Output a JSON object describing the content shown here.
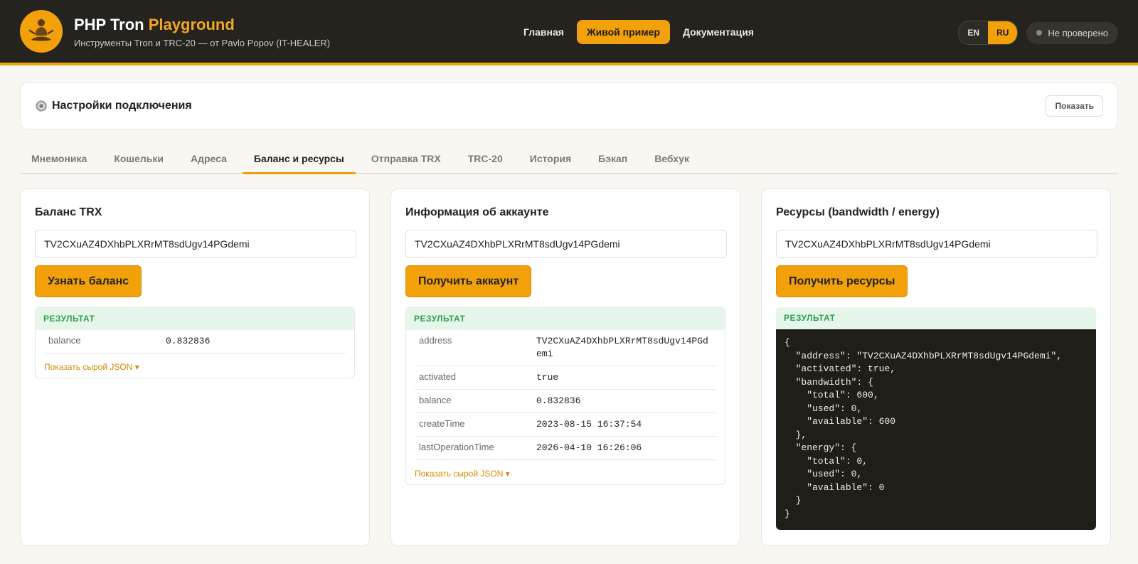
{
  "header": {
    "title_main": "PHP Tron",
    "title_accent": "Playground",
    "subtitle": "Инструменты Tron и TRC-20 — от Pavlo Popov (IT-HEALER)",
    "nav": [
      {
        "label": "Главная"
      },
      {
        "label": "Живой пример"
      },
      {
        "label": "Документация"
      }
    ],
    "lang": [
      "EN",
      "RU"
    ],
    "status": "Не проверено"
  },
  "settings": {
    "title": "Настройки подключения",
    "show_label": "Показать"
  },
  "tabs": [
    "Мнемоника",
    "Кошельки",
    "Адреса",
    "Баланс и ресурсы",
    "Отправка TRX",
    "TRC-20",
    "История",
    "Бэкап",
    "Вебхук"
  ],
  "active_tab": "Баланс и ресурсы",
  "result_label": "РЕЗУЛЬТАТ",
  "raw_json_label": "Показать сырой JSON ▾",
  "balance_panel": {
    "title": "Баланс TRX",
    "address": "TV2CXuAZ4DXhbPLXRrMT8sdUgv14PGdemi",
    "button": "Узнать баланс",
    "rows": [
      {
        "key": "balance",
        "value": "0.832836"
      }
    ]
  },
  "account_panel": {
    "title": "Информация об аккаунте",
    "address": "TV2CXuAZ4DXhbPLXRrMT8sdUgv14PGdemi",
    "button": "Получить аккаунт",
    "rows": [
      {
        "key": "address",
        "value": "TV2CXuAZ4DXhbPLXRrMT8sdUgv14PGdemi"
      },
      {
        "key": "activated",
        "value": "true"
      },
      {
        "key": "balance",
        "value": "0.832836"
      },
      {
        "key": "createTime",
        "value": "2023-08-15 16:37:54"
      },
      {
        "key": "lastOperationTime",
        "value": "2026-04-10 16:26:06"
      }
    ]
  },
  "resources_panel": {
    "title": "Ресурсы (bandwidth / energy)",
    "address": "TV2CXuAZ4DXhbPLXRrMT8sdUgv14PGdemi",
    "button": "Получить ресурсы",
    "json": "{\n  \"address\": \"TV2CXuAZ4DXhbPLXRrMT8sdUgv14PGdemi\",\n  \"activated\": true,\n  \"bandwidth\": {\n    \"total\": 600,\n    \"used\": 0,\n    \"available\": 600\n  },\n  \"energy\": {\n    \"total\": 0,\n    \"used\": 0,\n    \"available\": 0\n  }\n}"
  }
}
